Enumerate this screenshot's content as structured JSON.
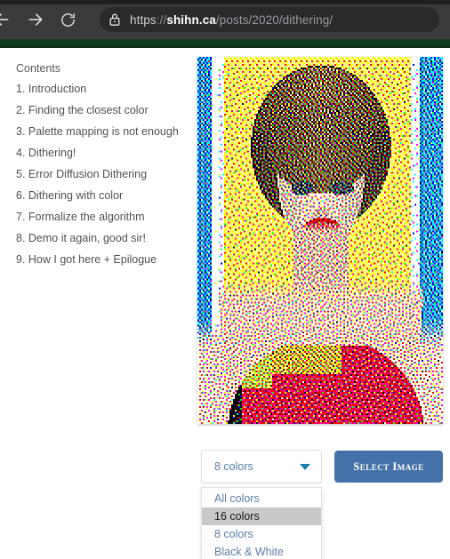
{
  "browser": {
    "back_icon": "arrow-left-icon",
    "forward_icon": "arrow-right-icon",
    "reload_icon": "reload-icon",
    "lock_icon": "lock-icon",
    "url": {
      "scheme": "https",
      "separator": "://",
      "host": "shihn.ca",
      "path": "/posts/2020/dithering/",
      "full": "https://shihn.ca/posts/2020/dithering/"
    },
    "chrome_color": "#3b3b3e",
    "accent_band_color": "#123a21"
  },
  "contents": {
    "title": "Contents",
    "items": [
      "1. Introduction",
      "2. Finding the closest color",
      "3. Palette mapping is not enough",
      "4. Dithering!",
      "5. Error Diffusion Dithering",
      "6. Dithering with color",
      "7. Formalize the algorithm",
      "8. Demo it again, good sir!",
      "9. How I got here + Epilogue"
    ]
  },
  "demo": {
    "image_name": "dithered-portrait-image",
    "palette_select": {
      "selected": "8 colors",
      "caret_icon": "chevron-down-icon",
      "caret_color": "#1b7ea8",
      "options": [
        {
          "label": "All colors",
          "highlighted": false
        },
        {
          "label": "16 colors",
          "highlighted": true
        },
        {
          "label": "8 colors",
          "highlighted": false
        },
        {
          "label": "Black & White",
          "highlighted": false
        }
      ]
    },
    "select_image_button": {
      "label": "Select Image",
      "background": "#4472a8",
      "text_color": "#ffffff"
    }
  }
}
